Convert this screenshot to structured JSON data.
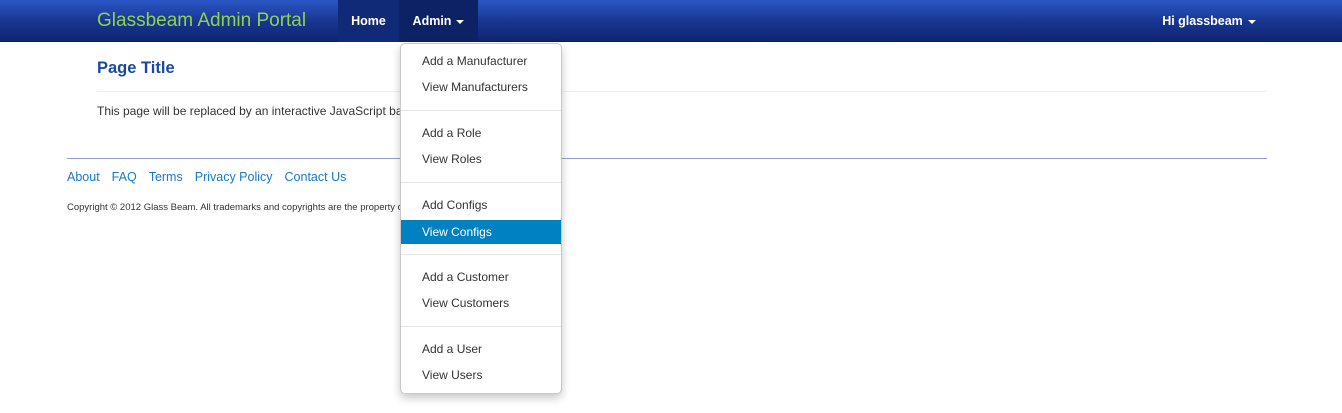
{
  "navbar": {
    "brand": "Glassbeam Admin Portal",
    "home_label": "Home",
    "admin_label": "Admin",
    "user_label": "Hi glassbeam"
  },
  "main": {
    "title": "Page Title",
    "text": "This page will be replaced by an interactive JavaScript based"
  },
  "footer": {
    "links": [
      "About",
      "FAQ",
      "Terms",
      "Privacy Policy",
      "Contact Us"
    ],
    "copyright": "Copyright © 2012 Glass Beam. All trademarks and copyrights are the property of their respective owners."
  },
  "dropdown": {
    "items": [
      "Add a Manufacturer",
      "View Manufacturers",
      "Add a Role",
      "View Roles",
      "Add Configs",
      "View Configs",
      "Add a Customer",
      "View Customers",
      "Add a User",
      "View Users"
    ],
    "active_item": "View Configs"
  },
  "colors": {
    "brand": "#8cd450",
    "navbar": "#17348e",
    "active": "#0081c2",
    "link": "#1a77c9",
    "title": "#1a4aa0"
  }
}
